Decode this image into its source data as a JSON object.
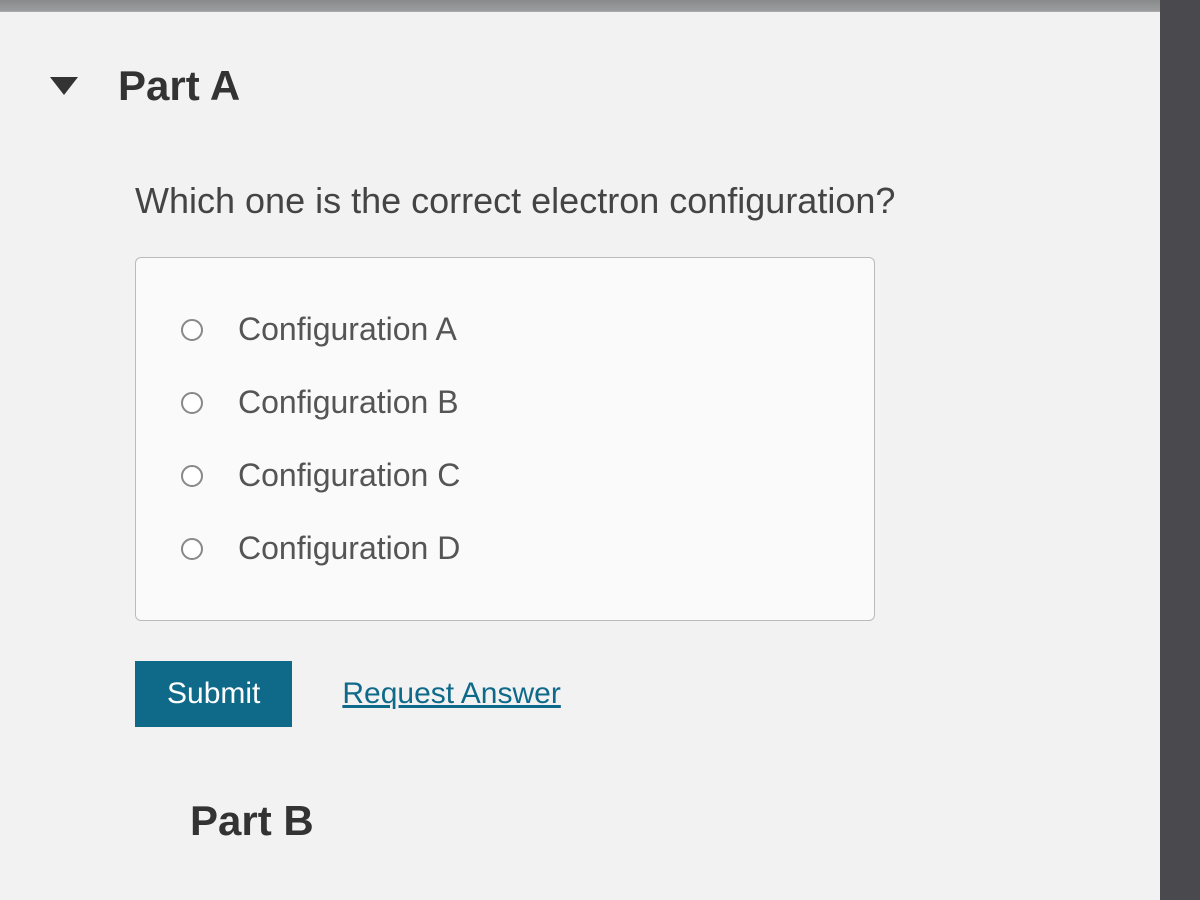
{
  "partA": {
    "title": "Part A",
    "question": "Which one is the correct electron configuration?",
    "options": [
      {
        "label": "Configuration A"
      },
      {
        "label": "Configuration B"
      },
      {
        "label": "Configuration C"
      },
      {
        "label": "Configuration D"
      }
    ],
    "submit_label": "Submit",
    "request_label": "Request Answer"
  },
  "partB": {
    "title": "Part B"
  }
}
